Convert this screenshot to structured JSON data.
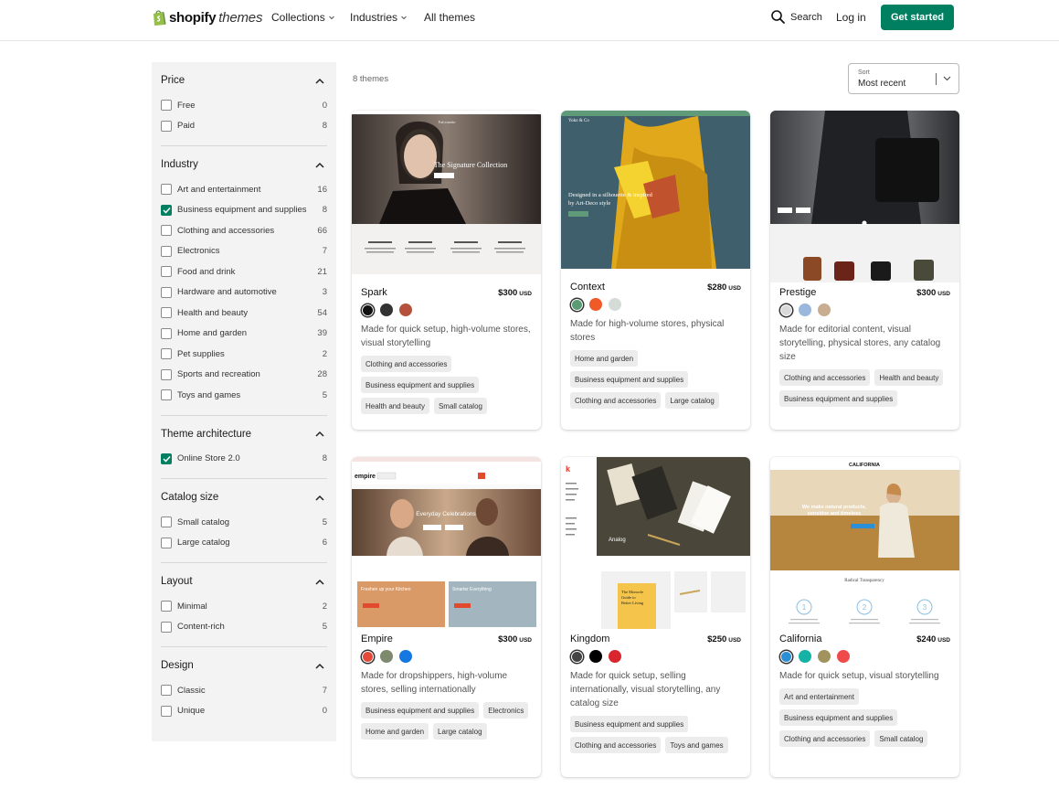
{
  "header": {
    "logo_main": "shopify",
    "logo_sub": "themes",
    "nav": [
      {
        "label": "Collections",
        "has_dropdown": true
      },
      {
        "label": "Industries",
        "has_dropdown": true
      },
      {
        "label": "All themes",
        "has_dropdown": false
      }
    ],
    "search_label": "Search",
    "login_label": "Log in",
    "cta_label": "Get started",
    "accent": "#008060"
  },
  "filters": [
    {
      "title": "Price",
      "options": [
        {
          "label": "Free",
          "count": "0",
          "checked": false
        },
        {
          "label": "Paid",
          "count": "8",
          "checked": false
        }
      ]
    },
    {
      "title": "Industry",
      "options": [
        {
          "label": "Art and entertainment",
          "count": "16",
          "checked": false
        },
        {
          "label": "Business equipment and supplies",
          "count": "8",
          "checked": true
        },
        {
          "label": "Clothing and accessories",
          "count": "66",
          "checked": false
        },
        {
          "label": "Electronics",
          "count": "7",
          "checked": false
        },
        {
          "label": "Food and drink",
          "count": "21",
          "checked": false
        },
        {
          "label": "Hardware and automotive",
          "count": "3",
          "checked": false
        },
        {
          "label": "Health and beauty",
          "count": "54",
          "checked": false
        },
        {
          "label": "Home and garden",
          "count": "39",
          "checked": false
        },
        {
          "label": "Pet supplies",
          "count": "2",
          "checked": false
        },
        {
          "label": "Sports and recreation",
          "count": "28",
          "checked": false
        },
        {
          "label": "Toys and games",
          "count": "5",
          "checked": false
        }
      ]
    },
    {
      "title": "Theme architecture",
      "options": [
        {
          "label": "Online Store 2.0",
          "count": "8",
          "checked": true
        }
      ]
    },
    {
      "title": "Catalog size",
      "options": [
        {
          "label": "Small catalog",
          "count": "5",
          "checked": false
        },
        {
          "label": "Large catalog",
          "count": "6",
          "checked": false
        }
      ]
    },
    {
      "title": "Layout",
      "options": [
        {
          "label": "Minimal",
          "count": "2",
          "checked": false
        },
        {
          "label": "Content-rich",
          "count": "5",
          "checked": false
        }
      ]
    },
    {
      "title": "Design",
      "options": [
        {
          "label": "Classic",
          "count": "7",
          "checked": false
        },
        {
          "label": "Unique",
          "count": "0",
          "checked": false
        }
      ]
    }
  ],
  "results": {
    "count_label": "8 themes",
    "sort_label": "Sort",
    "sort_value": "Most recent"
  },
  "themes": [
    {
      "name": "Spark",
      "price": "$300",
      "currency": "USD",
      "swatches": [
        "#111111",
        "#333333",
        "#b5523b"
      ],
      "description": "Made for quick setup, high-volume stores, visual storytelling",
      "tags": [
        "Clothing and accessories",
        "Business equipment and supplies",
        "Health and beauty",
        "Small catalog"
      ],
      "preview": {
        "brand": "Falconette",
        "headline": "The Signature Collection",
        "features": [
          "Heirloom Pieces",
          "Ethical Materials",
          "Free Shipping",
          "Perfect Gifts"
        ]
      }
    },
    {
      "name": "Context",
      "price": "$280",
      "currency": "USD",
      "swatches": [
        "#5a9b74",
        "#f05a28",
        "#d5dcd7"
      ],
      "description": "Made for high-volume stores, physical stores",
      "tags": [
        "Home and garden",
        "Business equipment and supplies",
        "Clothing and accessories",
        "Large catalog"
      ],
      "preview": {
        "brand": "Yoko & Co",
        "headline": "Designed in a silhouette & inspired by Art-Deco style"
      }
    },
    {
      "name": "Prestige",
      "price": "$300",
      "currency": "USD",
      "swatches": [
        "#d9d9d9",
        "#9ab8dd",
        "#c8ad90"
      ],
      "description": "Made for editorial content, visual storytelling, physical stores, any catalog size",
      "tags": [
        "Clothing and accessories",
        "Health and beauty",
        "Business equipment and supplies"
      ],
      "preview": {}
    },
    {
      "name": "Empire",
      "price": "$300",
      "currency": "USD",
      "swatches": [
        "#e6493a",
        "#7e8a6e",
        "#1478e0"
      ],
      "description": "Made for dropshippers, high-volume stores, selling internationally",
      "tags": [
        "Business equipment and supplies",
        "Electronics",
        "Home and garden",
        "Large catalog"
      ],
      "preview": {
        "brand": "empire",
        "headline": "Everyday Celebrations",
        "promo1": "Freshen up your Kitchen",
        "promo2": "Smarter Everything"
      }
    },
    {
      "name": "Kingdom",
      "price": "$250",
      "currency": "USD",
      "swatches": [
        "#444444",
        "#000000",
        "#d9262e"
      ],
      "description": "Made for quick setup, selling internationally, visual storytelling, any catalog size",
      "tags": [
        "Business equipment and supplies",
        "Clothing and accessories",
        "Toys and games"
      ],
      "preview": {
        "brand": "k",
        "headline": "Analog",
        "book": "The Monocle Guide to Better Living"
      }
    },
    {
      "name": "California",
      "price": "$240",
      "currency": "USD",
      "swatches": [
        "#2a8fd6",
        "#14b3a5",
        "#a1925e",
        "#f04b4b"
      ],
      "description": "Made for quick setup, visual storytelling",
      "tags": [
        "Art and entertainment",
        "Business equipment and supplies",
        "Clothing and accessories",
        "Small catalog"
      ],
      "preview": {
        "brand": "CALIFORNIA",
        "headline": "We make natural products, sensitive and timeless",
        "section": "Radical Transparency"
      }
    }
  ]
}
